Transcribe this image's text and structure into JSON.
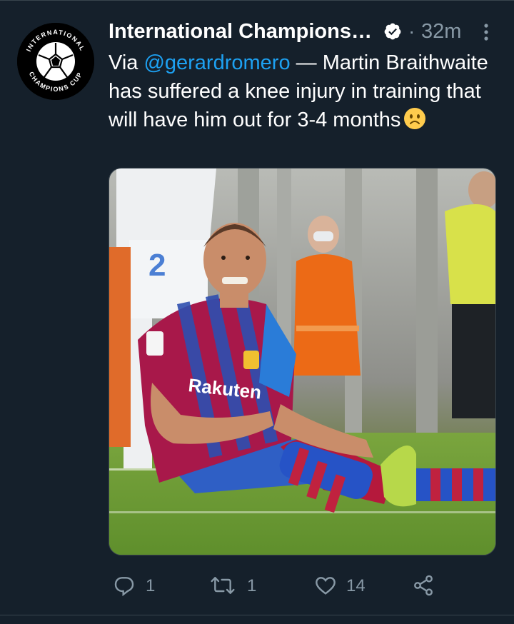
{
  "tweet": {
    "author": {
      "display_name": "International Champions…",
      "verified": true,
      "avatar_logo_text_top": "INTERNATIONAL",
      "avatar_logo_text_bottom": "CHAMPIONS CUP"
    },
    "time_separator": "·",
    "timestamp": "32m",
    "text": {
      "prefix": "Via ",
      "mention": "@gerardromero",
      "body": " — Martin Braithwaite has suffered a knee injury in training that will have him out for 3-4 months",
      "emoji": "slightly-frowning-face"
    },
    "media": {
      "alt_subject": "footballer-sitting-injured-on-pitch",
      "jersey_sponsor": "Rakuten",
      "jersey_number_background_player": "2"
    },
    "actions": {
      "reply_count": "1",
      "retweet_count": "1",
      "like_count": "14"
    }
  },
  "colors": {
    "background": "#15202b",
    "divider": "#38444d",
    "text_primary": "#ffffff",
    "text_secondary": "#8899a6",
    "link": "#1da1f2"
  }
}
